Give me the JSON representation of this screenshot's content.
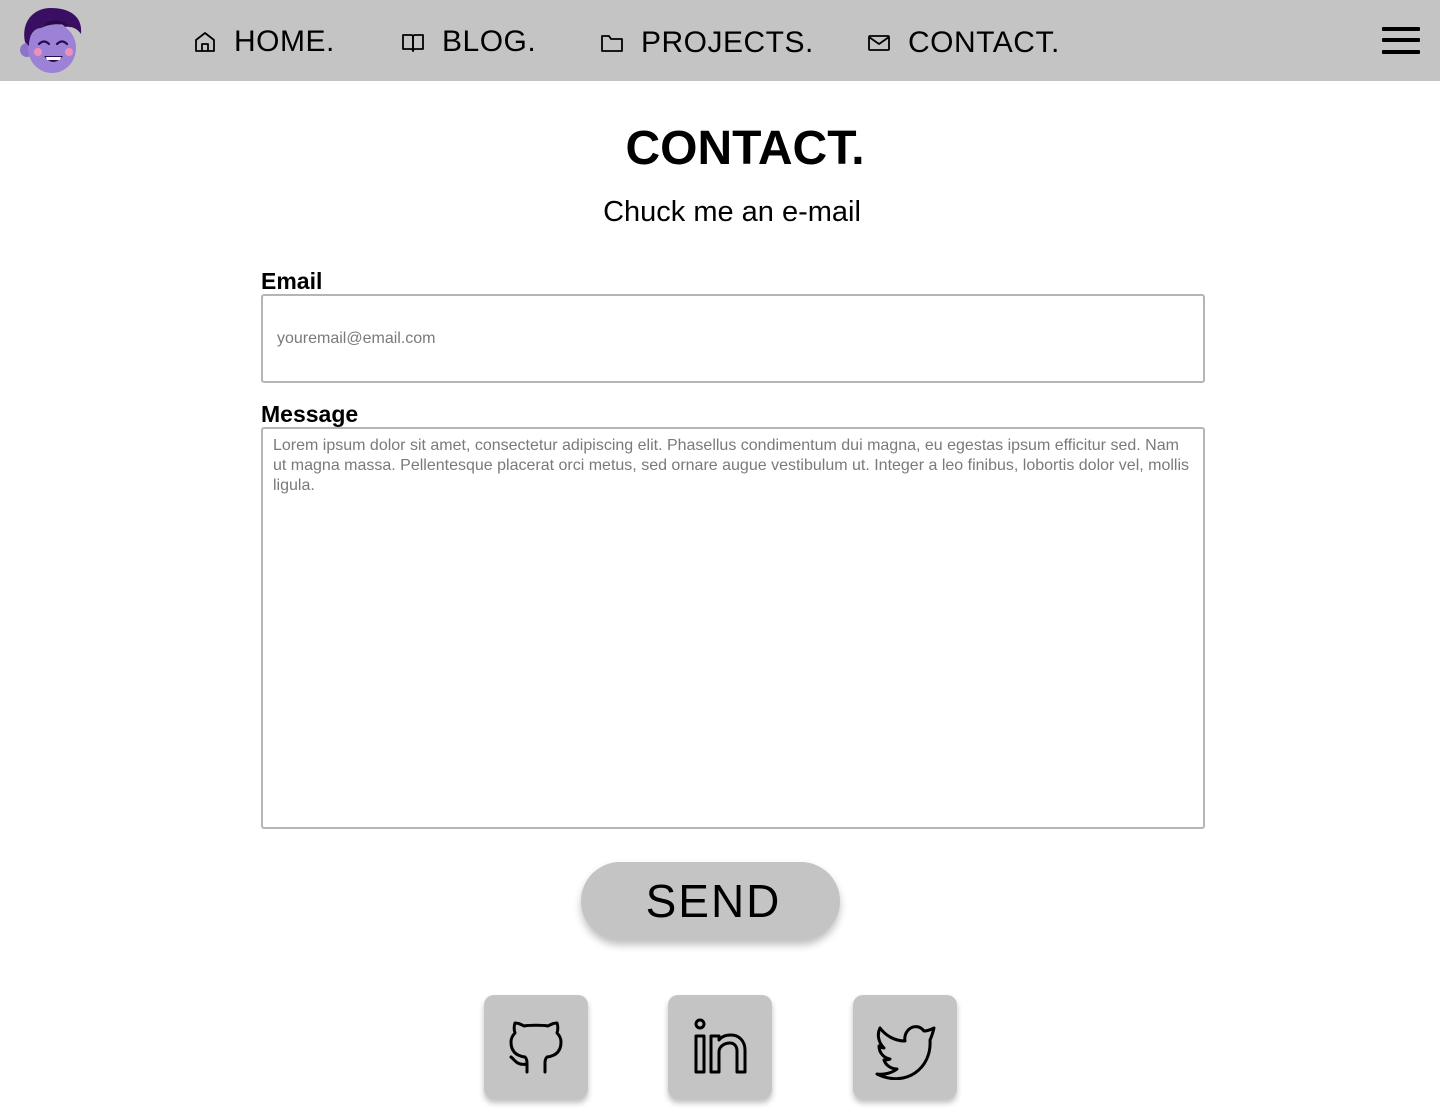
{
  "nav": {
    "items": [
      {
        "label": "HOME.",
        "icon": "home-icon"
      },
      {
        "label": "BLOG.",
        "icon": "book-icon"
      },
      {
        "label": "PROJECTS.",
        "icon": "folder-icon"
      },
      {
        "label": "CONTACT.",
        "icon": "mail-icon"
      }
    ],
    "menu_icon": "hamburger-menu-icon",
    "logo": "avatar-logo"
  },
  "page": {
    "title": "CONTACT.",
    "subtitle": "Chuck me an e-mail"
  },
  "form": {
    "email_label": "Email",
    "email_placeholder": "youremail@email.com",
    "message_label": "Message",
    "message_placeholder": "Lorem ipsum dolor sit amet, consectetur adipiscing elit. Phasellus condimentum dui magna, eu egestas ipsum efficitur sed. Nam ut magna massa. Pellentesque placerat orci metus, sed ornare augue vestibulum ut. Integer a leo finibus, lobortis dolor vel, mollis ligula.",
    "send_label": "SEND"
  },
  "social": [
    {
      "icon": "github-icon"
    },
    {
      "icon": "linkedin-icon"
    },
    {
      "icon": "twitter-icon"
    }
  ],
  "colors": {
    "nav_background": "#c4c4c4",
    "button_background": "#c4c4c4",
    "avatar_purple": "#9b82d6",
    "avatar_hair": "#3a0f63"
  }
}
